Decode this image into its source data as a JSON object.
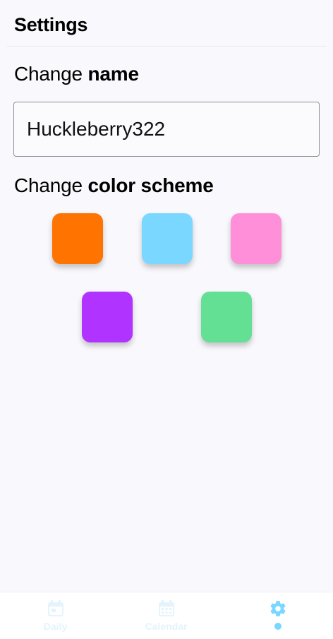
{
  "header": {
    "title": "Settings"
  },
  "name_section": {
    "label_prefix": "Change ",
    "label_strong": "name",
    "input_value": "Huckleberry322"
  },
  "color_section": {
    "label_prefix": "Change ",
    "label_strong": "color scheme",
    "swatches": [
      {
        "name": "orange",
        "color": "#ff7300"
      },
      {
        "name": "light-blue",
        "color": "#7ad7ff"
      },
      {
        "name": "pink",
        "color": "#ff8fd8"
      },
      {
        "name": "purple",
        "color": "#b033ff"
      },
      {
        "name": "green",
        "color": "#63e093"
      }
    ]
  },
  "tabbar": {
    "tabs": [
      {
        "label": "Daily",
        "icon": "calendar-day-icon",
        "active": false
      },
      {
        "label": "Calendar",
        "icon": "calendar-grid-icon",
        "active": false
      },
      {
        "label": "",
        "icon": "gear-icon",
        "active": true
      }
    ],
    "inactive_color": "#e3f4fc",
    "active_color": "#7ad7ff"
  }
}
